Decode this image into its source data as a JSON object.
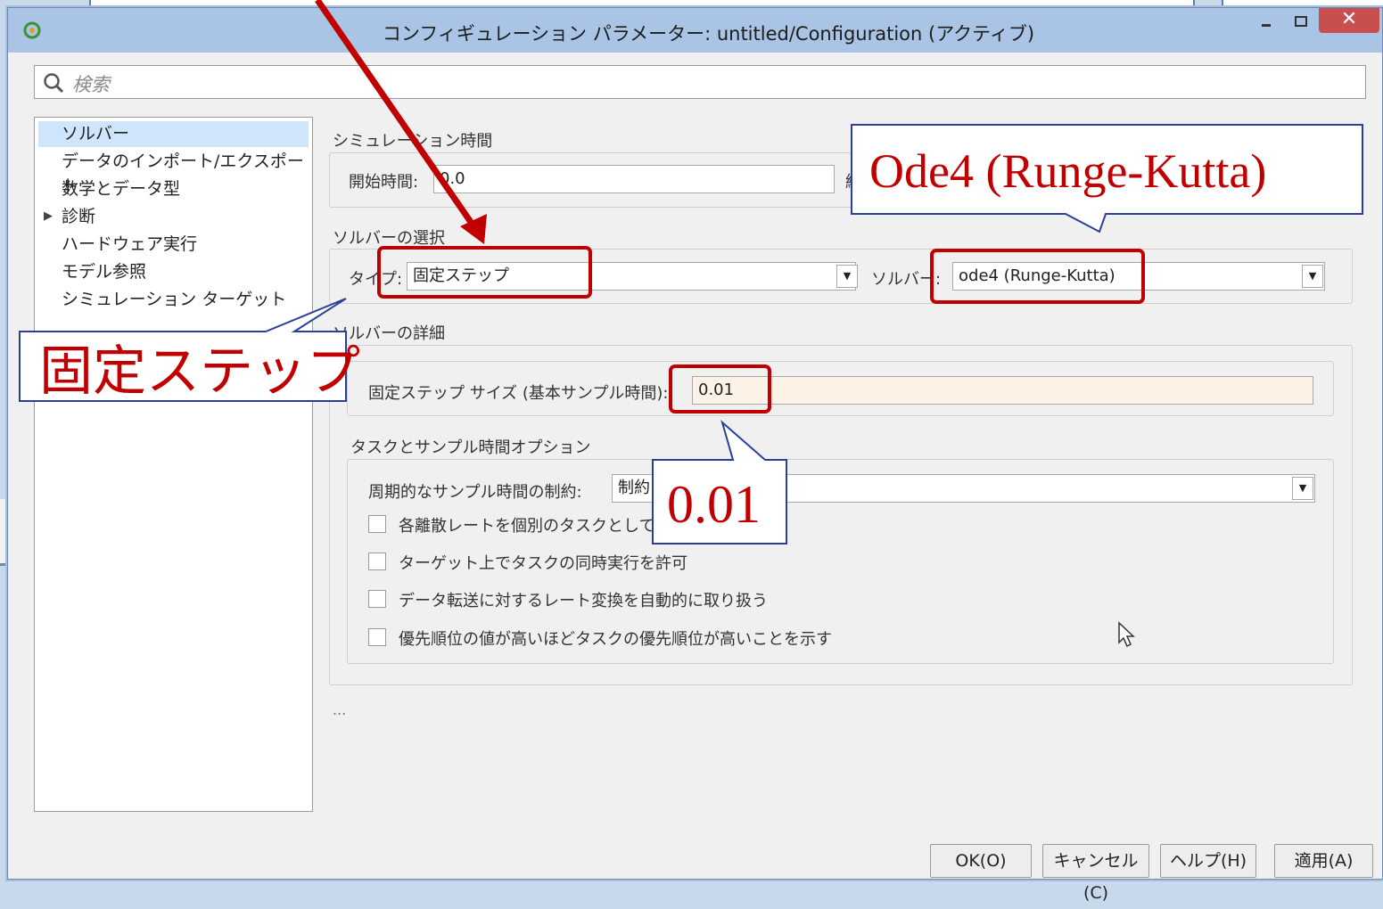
{
  "window": {
    "title": "コンフィギュレーション パラメーター: untitled/Configuration (アクティブ)",
    "minimize_glyph": "–",
    "maximize_glyph": "□",
    "close_glyph": "✕"
  },
  "search": {
    "placeholder": "検索",
    "icon": "search-icon"
  },
  "sidebar": {
    "items": [
      {
        "label": "ソルバー",
        "selected": true
      },
      {
        "label": "データのインポート/エクスポート"
      },
      {
        "label": "数学とデータ型"
      },
      {
        "label": "診断",
        "expandable": true,
        "arrow": "▶"
      },
      {
        "label": "ハードウェア実行"
      },
      {
        "label": "モデル参照"
      },
      {
        "label": "シミュレーション ターゲット"
      }
    ]
  },
  "simulation_time": {
    "group_label": "シミュレーション時間",
    "start_label": "開始時間:",
    "start_value": "0.0",
    "stop_label_partial": "終"
  },
  "solver_selection": {
    "group_label": "ソルバーの選択",
    "type_label": "タイプ:",
    "type_value": "固定ステップ",
    "solver_label": "ソルバー:",
    "solver_value": "ode4 (Runge-Kutta)"
  },
  "solver_details": {
    "group_label": "ソルバーの詳細",
    "step_size_label": "固定ステップ サイズ (基本サンプル時間):",
    "step_size_value": "0.01"
  },
  "task_options": {
    "group_label": "タスクとサンプル時間オプション",
    "periodic_label": "周期的なサンプル時間の制約:",
    "periodic_value": "制約",
    "checkboxes": [
      {
        "label": "各離散レートを個別のタスクとして",
        "checked": false
      },
      {
        "label": "ターゲット上でタスクの同時実行を許可",
        "checked": false
      },
      {
        "label": "データ転送に対するレート変換を自動的に取り扱う",
        "checked": false
      },
      {
        "label": "優先順位の値が高いほどタスクの優先順位が高いことを示す",
        "checked": false
      }
    ]
  },
  "ellipsis": "...",
  "buttons": {
    "ok": "OK(O)",
    "cancel": "キャンセル(C)",
    "help": "ヘルプ(H)",
    "apply": "適用(A)"
  },
  "annotations": {
    "solver_callout": "Ode4 (Runge-Kutta)",
    "type_callout": "固定ステップ",
    "step_callout": "0.01",
    "color": "#c00000"
  },
  "colors": {
    "titlebar": "#a9c4e4",
    "close_button": "#c7504e",
    "selected_item": "#cfe5fb",
    "step_size_field": "#fdf2e6",
    "annotation_red": "#c00000",
    "callout_border": "#2a3f9a"
  }
}
